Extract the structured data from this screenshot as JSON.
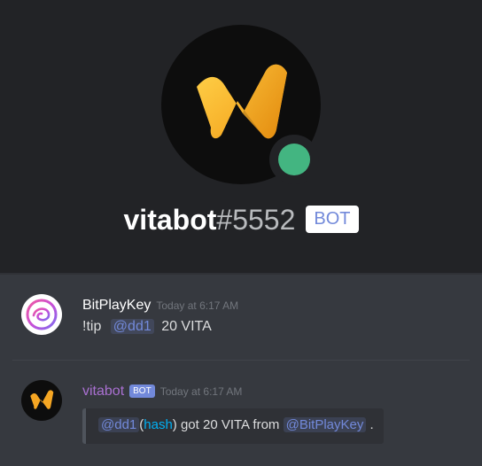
{
  "profile": {
    "name": "vitabot",
    "discriminator": "#5552",
    "badge": "BOT"
  },
  "messages": [
    {
      "author": "BitPlayKey",
      "time": "Today at 6:17 AM",
      "text_before": "!tip",
      "mention": "@dd1",
      "text_after": "20 VITA"
    },
    {
      "author": "vitabot",
      "tag": "BOT",
      "time": "Today at 6:17 AM",
      "embed": {
        "mention_user": "@dd1",
        "paren_open": "(",
        "link": "hash",
        "paren_close": ")",
        "text_middle": "got 20 VITA from",
        "mention_sender": "@BitPlayKey",
        "text_end": "."
      }
    }
  ],
  "colors": {
    "online": "#43b581",
    "bot_badge": "#7289da",
    "vitabot_name": "#a970d1",
    "logo_orange": "#f5a623"
  },
  "icons": {
    "vitabot_logo": "lightning-v-logo",
    "bitplaykey_logo": "swirl-logo"
  }
}
